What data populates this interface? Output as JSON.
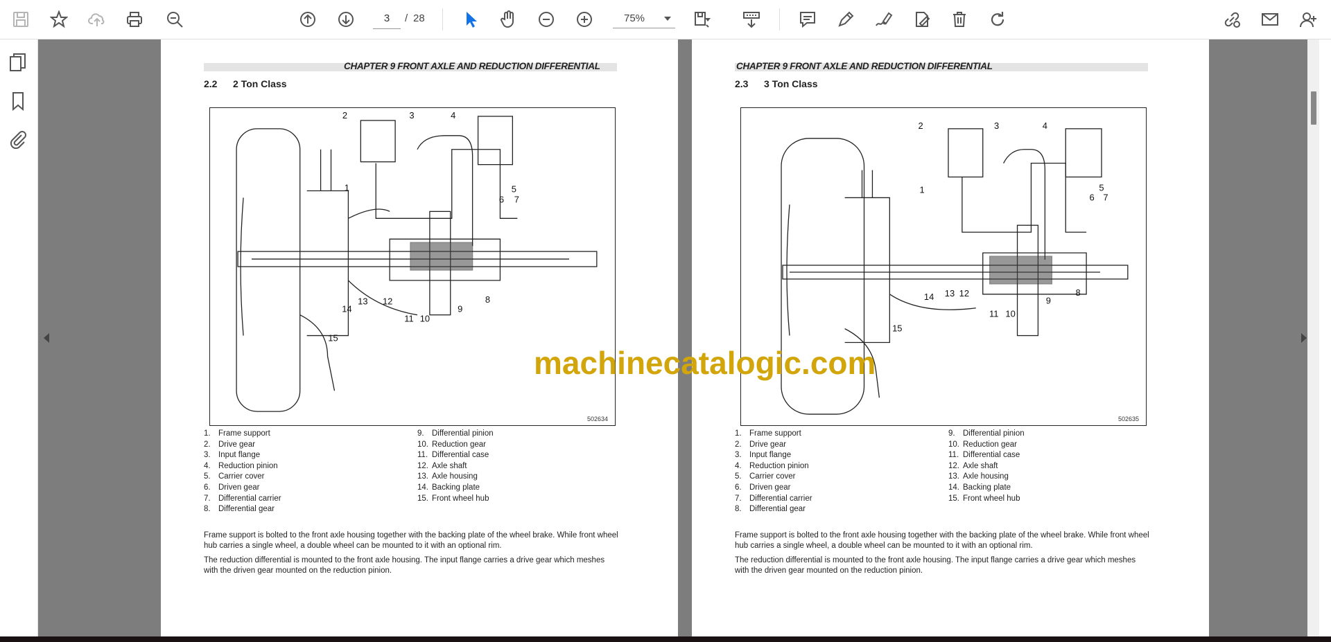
{
  "toolbar": {
    "page_current": "3",
    "page_separator": "/",
    "page_total": "28",
    "zoom": "75%",
    "icons": [
      "save-icon",
      "bookmark-star-icon",
      "upload-cloud-icon",
      "print-icon",
      "zoom-search-icon",
      "previous-page-icon",
      "next-page-icon",
      "select-cursor-icon",
      "hand-pan-icon",
      "zoom-out-icon",
      "zoom-in-icon",
      "fit-page-icon",
      "scroll-mode-icon",
      "comment-icon",
      "highlight-pen-icon",
      "sign-icon",
      "edit-pdf-icon",
      "delete-icon",
      "rotate-icon",
      "share-link-icon",
      "email-icon",
      "add-user-icon"
    ],
    "accent_color": "#1473e6"
  },
  "left_rail": {
    "icons": [
      "pages-thumbnail-icon",
      "bookmark-icon",
      "attachment-icon"
    ]
  },
  "pages": [
    {
      "chapter": "CHAPTER 9 FRONT AXLE AND REDUCTION DIFFERENTIAL",
      "section_number": "2.2",
      "section_title": "2 Ton Class",
      "figure_id": "502634",
      "legend_left": [
        {
          "n": "1.",
          "t": "Frame support"
        },
        {
          "n": "2.",
          "t": "Drive gear"
        },
        {
          "n": "3.",
          "t": "Input flange"
        },
        {
          "n": "4.",
          "t": "Reduction pinion"
        },
        {
          "n": "5.",
          "t": "Carrier cover"
        },
        {
          "n": "6.",
          "t": "Driven gear"
        },
        {
          "n": "7.",
          "t": "Differential carrier"
        },
        {
          "n": "8.",
          "t": "Differential gear"
        }
      ],
      "legend_right": [
        {
          "n": "9.",
          "t": "Differential pinion"
        },
        {
          "n": "10.",
          "t": "Reduction gear"
        },
        {
          "n": "11.",
          "t": "Differential case"
        },
        {
          "n": "12.",
          "t": "Axle shaft"
        },
        {
          "n": "13.",
          "t": "Axle housing"
        },
        {
          "n": "14.",
          "t": "Backing plate"
        },
        {
          "n": "15.",
          "t": "Front wheel hub"
        }
      ],
      "para1": "Frame support is bolted to the front axle housing together with the backing plate of the wheel brake. While front wheel hub carries a single wheel, a double wheel can be mounted to it with an optional rim.",
      "para2": "The reduction differential is mounted to the front axle housing. The input flange carries a drive gear which meshes with the driven gear mounted on the reduction pinion."
    },
    {
      "chapter": "CHAPTER 9 FRONT AXLE AND REDUCTION DIFFERENTIAL",
      "section_number": "2.3",
      "section_title": "3 Ton Class",
      "figure_id": "502635",
      "legend_left": [
        {
          "n": "1.",
          "t": "Frame support"
        },
        {
          "n": "2.",
          "t": "Drive gear"
        },
        {
          "n": "3.",
          "t": "Input flange"
        },
        {
          "n": "4.",
          "t": "Reduction pinion"
        },
        {
          "n": "5.",
          "t": "Carrier cover"
        },
        {
          "n": "6.",
          "t": "Driven gear"
        },
        {
          "n": "7.",
          "t": "Differential carrier"
        },
        {
          "n": "8.",
          "t": "Differential gear"
        }
      ],
      "legend_right": [
        {
          "n": "9.",
          "t": "Differential pinion"
        },
        {
          "n": "10.",
          "t": "Reduction gear"
        },
        {
          "n": "11.",
          "t": "Differential case"
        },
        {
          "n": "12.",
          "t": "Axle shaft"
        },
        {
          "n": "13.",
          "t": "Axle housing"
        },
        {
          "n": "14.",
          "t": "Backing plate"
        },
        {
          "n": "15.",
          "t": "Front wheel hub"
        }
      ],
      "para1": "Frame support is bolted to the front axle housing together with the backing plate of the wheel brake. While front wheel hub carries a single wheel, a double wheel can be mounted to it with an optional rim.",
      "para2": "The reduction differential is mounted to the front axle housing. The input flange carries a drive gear which meshes with the driven gear mounted on the reduction pinion."
    }
  ],
  "callouts": [
    "1",
    "2",
    "3",
    "4",
    "5",
    "6",
    "7",
    "8",
    "9",
    "10",
    "11",
    "12",
    "13",
    "14",
    "15"
  ],
  "watermark": "machinecatalogic.com"
}
